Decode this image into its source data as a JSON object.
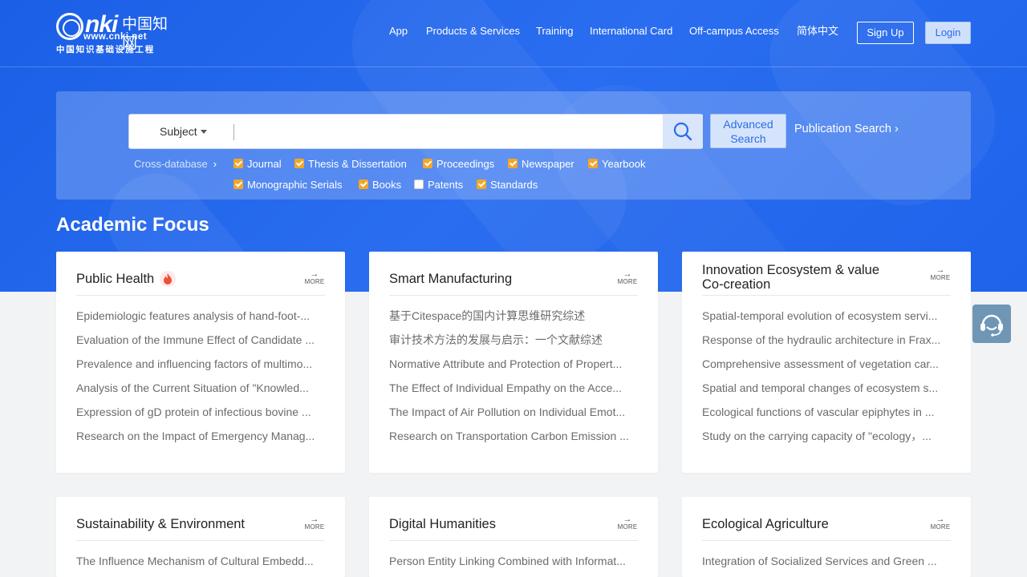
{
  "logo": {
    "word": "nki",
    "cn": "中国知网",
    "url": "www.cnki.net",
    "sub": "中国知识基础设施工程"
  },
  "nav": {
    "items": [
      "App",
      "Products & Services",
      "Training",
      "International Card",
      "Off-campus Access",
      "简体中文"
    ],
    "signup": "Sign Up",
    "login": "Login"
  },
  "search": {
    "subject": "Subject",
    "input_value": "",
    "advanced": [
      "Advanced",
      "Search"
    ],
    "publication": "Publication Search",
    "cross_db": "Cross-database",
    "databases": [
      {
        "label": "Journal",
        "checked": true
      },
      {
        "label": "Thesis & Dissertation",
        "checked": true
      },
      {
        "label": "Proceedings",
        "checked": true
      },
      {
        "label": "Newspaper",
        "checked": true
      },
      {
        "label": "Yearbook",
        "checked": true
      },
      {
        "label": "Monographic Serials",
        "checked": true
      },
      {
        "label": "Books",
        "checked": true
      },
      {
        "label": "Patents",
        "checked": false
      },
      {
        "label": "Standards",
        "checked": true
      }
    ]
  },
  "academic_focus": {
    "title": "Academic Focus",
    "more_label": "MORE",
    "cards": [
      {
        "title": "Public Health",
        "hot": true,
        "items": [
          "Epidemiologic features analysis of hand-foot-...",
          "Evaluation of the Immune Effect of Candidate ...",
          "Prevalence and influencing factors of multimo...",
          "Analysis of the Current Situation of \"Knowled...",
          "Expression of gD protein of infectious bovine ...",
          "Research on the Impact of Emergency Manag..."
        ]
      },
      {
        "title": "Smart Manufacturing",
        "items": [
          "基于Citespace的国内计算思维研究综述",
          "审计技术方法的发展与启示：一个文献综述",
          "Normative Attribute and Protection of Propert...",
          "The Effect of Individual Empathy on the Acce...",
          "The Impact of Air Pollution on Individual Emot...",
          "Research on Transportation Carbon Emission ..."
        ]
      },
      {
        "title": "Innovation Ecosystem & value Co-creation",
        "items": [
          "Spatial-temporal evolution of ecosystem servi...",
          "Response of the hydraulic architecture in Frax...",
          "Comprehensive assessment of vegetation car...",
          "Spatial and temporal changes of ecosystem s...",
          "Ecological functions of vascular epiphytes in ...",
          "Study on the carrying capacity of \"ecology，..."
        ]
      },
      {
        "title": "Sustainability & Environment",
        "items": [
          "The Influence Mechanism of Cultural Embedd..."
        ]
      },
      {
        "title": "Digital Humanities",
        "items": [
          "Person Entity Linking Combined with Informat..."
        ]
      },
      {
        "title": "Ecological Agriculture",
        "items": [
          "Integration of Socialized Services and Green ..."
        ]
      }
    ]
  },
  "colors": {
    "hero_blue": "#1a5fe6",
    "accent_orange": "#f5a623",
    "link_blue": "#2b6ce8"
  },
  "icons": [
    "search-icon",
    "fire-icon",
    "arrow-right-icon",
    "customer-service-icon",
    "chevron-right-icon",
    "caret-down-icon"
  ]
}
